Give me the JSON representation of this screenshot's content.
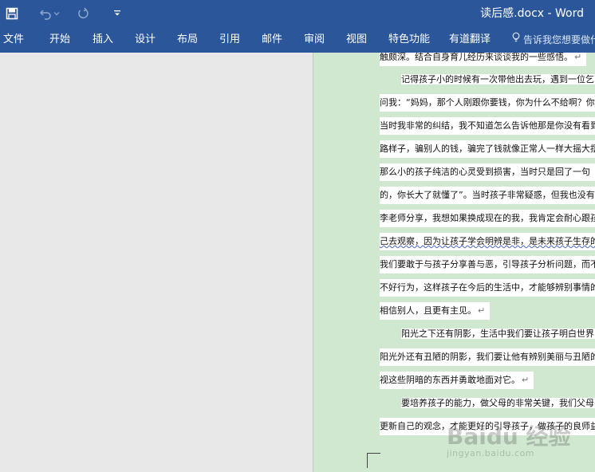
{
  "window": {
    "title": "读后感.docx - Word"
  },
  "quick_access": {
    "save_icon": "save-icon",
    "undo_icon": "undo-icon",
    "undo_dropdown_icon": "chevron-down-icon",
    "redo_icon": "redo-icon",
    "customize_icon": "customize-qat-icon"
  },
  "menu": {
    "items": [
      {
        "label": "文件"
      },
      {
        "label": "开始"
      },
      {
        "label": "插入"
      },
      {
        "label": "设计"
      },
      {
        "label": "布局"
      },
      {
        "label": "引用"
      },
      {
        "label": "邮件"
      },
      {
        "label": "审阅"
      },
      {
        "label": "视图"
      },
      {
        "label": "特色功能"
      },
      {
        "label": "有道翻译"
      }
    ],
    "tell_me": "告诉我您想要做什么",
    "tell_me_icon": "lightbulb-icon"
  },
  "document": {
    "lines": [
      "触颇深。结合自身育儿经历来谈谈我的一些感悟。",
      "记得孩子小的时候有一次带他出去玩，遇到一位乞丐",
      "问我：“妈妈，那个人刚跟你要钱，你为什么不给啊？你",
      "当时我非常的纠结，我不知道怎么告诉他那是你没有看到",
      "路样子，骗别人的钱，骗完了钱就像正常人一样大摇大摆",
      "那么小的孩子纯洁的心灵受到损害，当时只是回了一句",
      "的，你长大了就懂了”。当时孩子非常疑惑，但我也没有",
      "李老师分享，我想如果换成现在的我，我肯定会耐心跟孩",
      "己去观察，因为让孩子学会明辨是非，是未来孩子生存的",
      "我们要敢于与孩子分享善与恶，引导孩子分析问题，而不",
      "不好行为，这样孩子在今后的生活中，才能够辨别事情的",
      "相信别人，且更有主见。",
      "阳光之下还有阴影，生活中我们要让孩子明白世界",
      "阳光外还有丑陋的阴影，我们要让他有辨别美丽与丑陋的",
      "视这些阴暗的东西并勇敢地面对它。",
      "要培养孩子的能力，做父母的非常关键，我们父母要",
      "更新自己的观念，才能更好的引导孩子，做孩子的良师益"
    ]
  },
  "watermark": {
    "brand": "Baidu 经验",
    "url": "jingyan.baidu.com"
  }
}
